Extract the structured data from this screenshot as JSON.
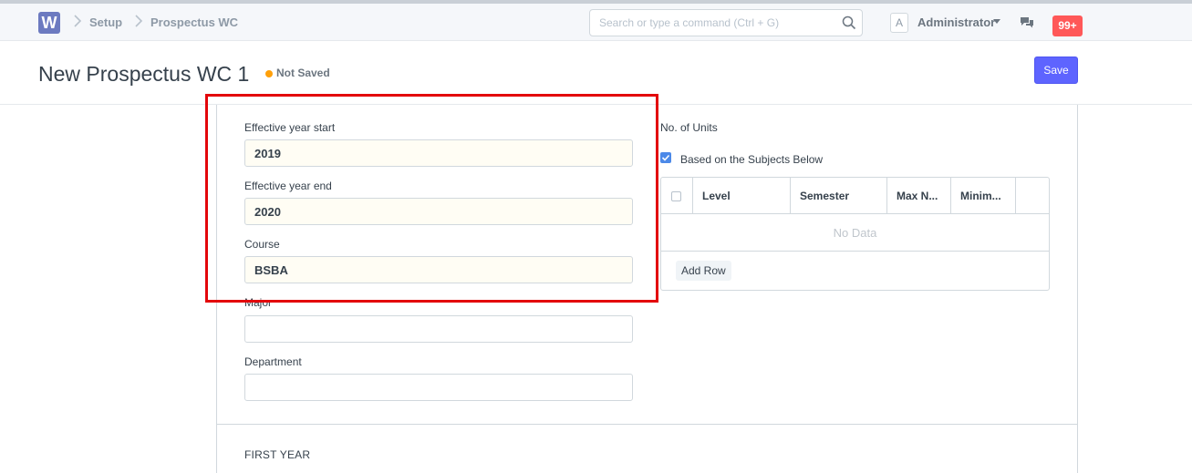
{
  "navbar": {
    "logo_text": "W",
    "breadcrumbs": [
      "Setup",
      "Prospectus WC"
    ],
    "search_placeholder": "Search or type a command (Ctrl + G)",
    "avatar_letter": "A",
    "user_name": "Administrator",
    "notification_count": "99+"
  },
  "page": {
    "title": "New Prospectus WC 1",
    "status": "Not Saved",
    "status_color": "#ffa00a",
    "save_label": "Save",
    "accent_color": "#5e64ff"
  },
  "form": {
    "fields": [
      {
        "label": "Effective year start",
        "value": "2019"
      },
      {
        "label": "Effective year end",
        "value": "2020"
      },
      {
        "label": "Course",
        "value": "BSBA"
      },
      {
        "label": "Major",
        "value": ""
      },
      {
        "label": "Department",
        "value": ""
      }
    ],
    "units_label": "No. of Units",
    "checkbox_label": "Based on the Subjects Below",
    "checkbox_checked": true,
    "grid": {
      "columns": [
        "Level",
        "Semester",
        "Max N...",
        "Minim..."
      ],
      "empty_text": "No Data",
      "add_row_label": "Add Row"
    },
    "section_title": "FIRST YEAR"
  },
  "annotation": {
    "highlight_color": "#e3060b"
  }
}
